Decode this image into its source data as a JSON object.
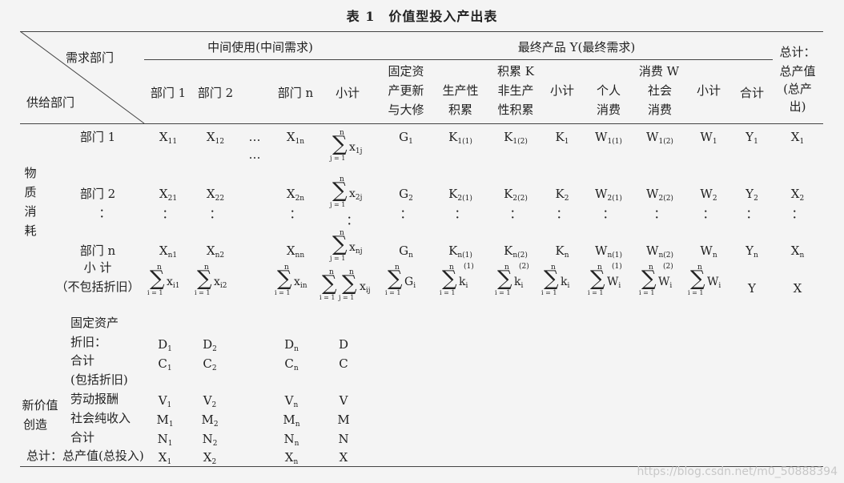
{
  "title": "表 1　价值型投入产出表",
  "header": {
    "demand": "需求部门",
    "supply": "供给部门",
    "intermediate": "中间使用(中间需求)",
    "final": "最终产品 Y(最终需求)",
    "total_1": "总计：",
    "total_2": "总产值",
    "total_3": "(总产",
    "total_4": "出)",
    "dept1": "部门 1",
    "dept2": "部门 2",
    "deptn": "部门 n",
    "subtotal": "小计",
    "fixed_1": "固定资",
    "fixed_2": "产更新",
    "fixed_3": "与大修",
    "accum": "积累 K",
    "prod_1": "生产性",
    "prod_2": "积累",
    "nonprod_1": "非生产",
    "nonprod_2": "性积累",
    "accum_sub": "小计",
    "consume": "消费 W",
    "personal_1": "个人",
    "personal_2": "消费",
    "social_1": "社会",
    "social_2": "消费",
    "consume_sub": "小计",
    "sum": "合计"
  },
  "rows": {
    "material_1": "物",
    "material_2": "质",
    "material_3": "消",
    "material_4": "耗",
    "r_dept1": "部门 1",
    "r_dept2": "部门 2",
    "r_colon": "：",
    "r_deptn": "部门 n",
    "r_sub_1": "小 计",
    "r_sub_2": "（不包括折旧）",
    "newvalue_1": "新价值",
    "newvalue_2": "创造",
    "depr_1": "固定资产",
    "depr_2": "折旧：",
    "total_dep_1": "合计",
    "total_dep_2": "(包括折旧)",
    "labor": "劳动报酬",
    "net": "社会纯收入",
    "nsum": "合计",
    "grand": "总计：总产值(总投入)"
  },
  "cells": {
    "X": "X",
    "G": "G",
    "K": "K",
    "W": "W",
    "Y": "Y",
    "D": "D",
    "C": "C",
    "V": "V",
    "M": "M",
    "N": "N",
    "dots": "…",
    "vdots": "："
  },
  "subs": {
    "s11": "11",
    "s12": "12",
    "s1n": "1n",
    "s1": "1",
    "s21": "21",
    "s22": "22",
    "s2n": "2n",
    "s2": "2",
    "sn1": "n1",
    "sn2": "n2",
    "snn": "nn",
    "sn": "n",
    "k11": "1(1)",
    "k12": "1(2)",
    "k21": "2(1)",
    "k22": "2(2)",
    "kn1": "n(1)",
    "kn2": "n(2)"
  },
  "sums": {
    "sigma": "∑",
    "n": "n",
    "j1": "j = 1",
    "i1": "i = 1",
    "x1j": "x",
    "x2j": "x",
    "xnj": "x",
    "xi1": "x",
    "xi2": "x",
    "xin": "x",
    "xij": "x",
    "sub1j": "1j",
    "sub2j": "2j",
    "subnj": "nj",
    "subi1": "i1",
    "subi2": "i2",
    "subin": "in",
    "subij": "ij",
    "Gi": "G",
    "ki": "k",
    "Wi": "W",
    "i": "i",
    "sup1": "(1)",
    "sup2": "(2)"
  },
  "watermark": "https://blog.csdn.net/m0_50888394"
}
